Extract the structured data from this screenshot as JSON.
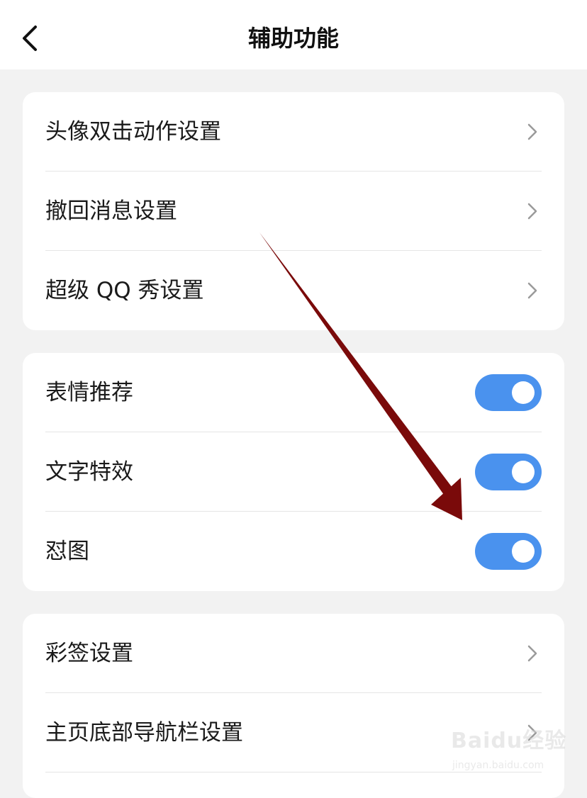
{
  "header": {
    "title": "辅助功能",
    "back_icon": "chevron-left-icon"
  },
  "groups": [
    {
      "items": [
        {
          "label": "头像双击动作设置",
          "control": "chevron"
        },
        {
          "label": "撤回消息设置",
          "control": "chevron"
        },
        {
          "label": "超级 QQ 秀设置",
          "control": "chevron"
        }
      ]
    },
    {
      "items": [
        {
          "label": "表情推荐",
          "control": "toggle",
          "on": true
        },
        {
          "label": "文字特效",
          "control": "toggle",
          "on": true
        },
        {
          "label": "怼图",
          "control": "toggle",
          "on": true
        }
      ]
    },
    {
      "items": [
        {
          "label": "彩签设置",
          "control": "chevron"
        },
        {
          "label": "主页底部导航栏设置",
          "control": "chevron"
        }
      ]
    }
  ],
  "colors": {
    "toggle_on": "#4a92ee",
    "background": "#f2f2f2",
    "annotation_arrow": "#7a0a0a"
  },
  "watermark": {
    "brand": "Baidu经验",
    "url": "jingyan.baidu.com"
  }
}
